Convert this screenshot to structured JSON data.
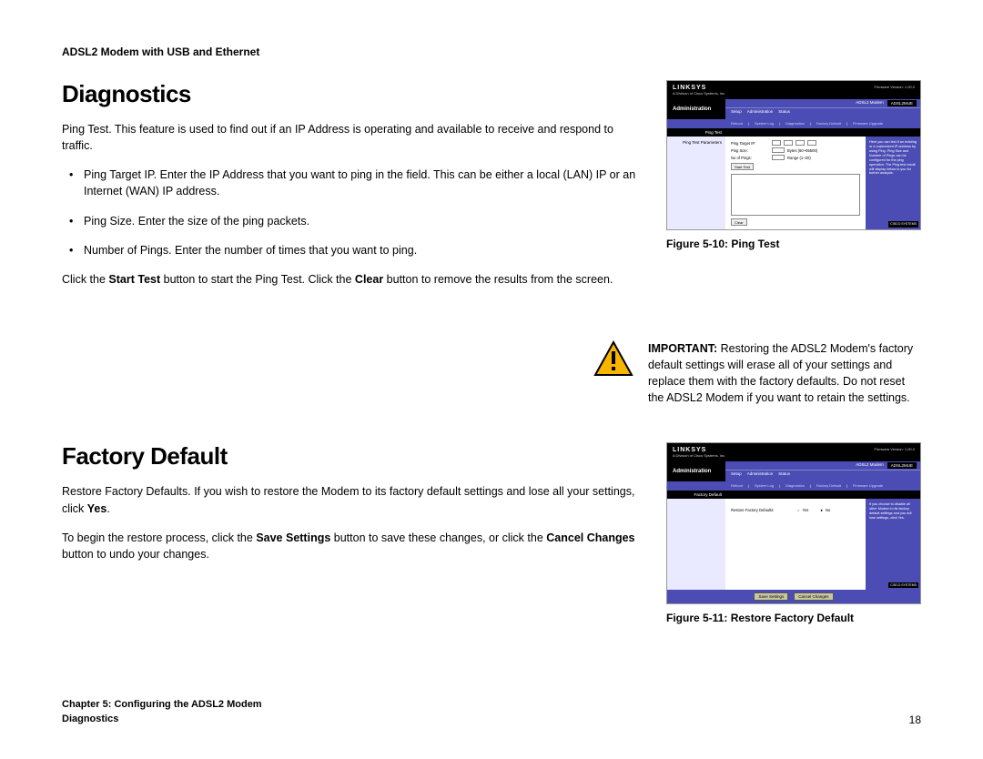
{
  "header": {
    "product_line": "ADSL2 Modem with USB and Ethernet"
  },
  "diagnostics": {
    "heading": "Diagnostics",
    "intro": "Ping Test. This feature is used to find out if an IP Address is operating and available to receive and respond to traffic.",
    "bullets": [
      "Ping Target IP. Enter the IP Address that you want to ping in the field. This can be either a local (LAN) IP or an Internet (WAN) IP address.",
      "Ping Size. Enter the size of the ping packets.",
      "Number of Pings. Enter the number of times that you want to ping."
    ],
    "closing_pre": "Click the ",
    "closing_b1": "Start Test",
    "closing_mid": " button to start the Ping Test. Click the ",
    "closing_b2": "Clear",
    "closing_post": " button to remove the results from the screen."
  },
  "figure10": {
    "caption": "Figure 5-10: Ping Test",
    "brand": "LINKSYS",
    "brand_sub": "A Division of Cisco Systems, Inc.",
    "firmware": "Firmware Version: 1.00.0",
    "section": "Administration",
    "model_label": "ADSL2 Modem",
    "model": "ADSL2MUE",
    "tabs": [
      "Setup",
      "Administration",
      "Status"
    ],
    "subtabs": [
      "Reboot",
      "System Log",
      "Diagnostics",
      "Factory Default",
      "Firmware Upgrade"
    ],
    "crumb": "Ping Test",
    "panel_label": "Ping Test Parameters",
    "fields": {
      "target": "Ping Target IP:",
      "size": "Ping Size:",
      "size_hint": "Bytes (60~65500)",
      "num": "No of Pings:",
      "num_hint": "Range (1~20)"
    },
    "start_btn": "Start Test",
    "clear_btn": "Clear",
    "help": "Here you can test if an existing or a customized IP address by using Ping. Ping Size and Number of Pings can be configured for the ping operation. The Ping test result will display below to you for further analysis.",
    "cisco": "CISCO SYSTEMS"
  },
  "important": {
    "label": "IMPORTANT:",
    "text": " Restoring the ADSL2 Modem's factory default settings will erase all of your settings and replace them with the factory defaults. Do not reset the ADSL2 Modem if you want to retain the settings."
  },
  "factory": {
    "heading": "Factory Default",
    "p1_pre": "Restore Factory Defaults. If you wish to restore the Modem to its factory default settings and lose all your settings, click ",
    "p1_b": "Yes",
    "p1_post": ".",
    "p2_pre": "To begin the restore process, click the ",
    "p2_b1": "Save Settings",
    "p2_mid": " button to save these changes, or click the ",
    "p2_b2": "Cancel Changes",
    "p2_post": " button to undo your changes."
  },
  "figure11": {
    "caption": "Figure 5-11: Restore Factory Default",
    "crumb": "Factory Default",
    "panel_label": "",
    "field_label": "Restore Factory Defaults:",
    "opt_yes": "Yes",
    "opt_no": "No",
    "help": "If you choose to disable all other Modem to its factory default settings and you will lose settings, click Yes.",
    "save": "Save Settings",
    "cancel": "Cancel Changes"
  },
  "footer": {
    "chapter": "Chapter 5: Configuring the ADSL2 Modem",
    "section": "Diagnostics",
    "page": "18"
  }
}
